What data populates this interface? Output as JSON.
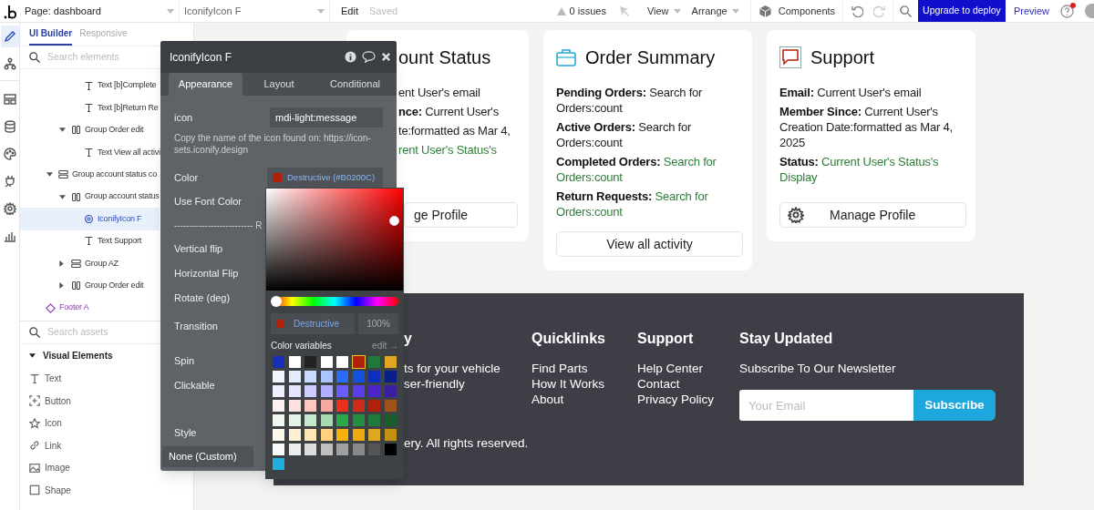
{
  "topbar": {
    "page_select": "Page: dashboard",
    "element_select": "IconifyIcon F",
    "edit": "Edit",
    "saved": "Saved",
    "issues": "0 issues",
    "view": "View",
    "arrange": "Arrange",
    "components": "Components",
    "upgrade": "Upgrade to deploy",
    "preview": "Preview",
    "help_notification": true
  },
  "rail": [
    {
      "kind": "pencil",
      "selected": true
    },
    {
      "kind": "tree",
      "selected": false
    },
    {
      "kind": "layout",
      "selected": false
    },
    {
      "kind": "database",
      "selected": false
    },
    {
      "kind": "palette",
      "selected": false
    },
    {
      "kind": "plug",
      "selected": false
    },
    {
      "kind": "gear",
      "selected": false
    },
    {
      "kind": "chart",
      "selected": false
    }
  ],
  "sidebar": {
    "tabs": [
      {
        "label": "UI Builder",
        "selected": true
      },
      {
        "label": "Responsive",
        "selected": false
      }
    ],
    "search": {
      "placeholder": "Search elements"
    },
    "tree": [
      {
        "children": [
          {
            "children": [
              {
                "children": [
                  {
                    "label": "Text [b]Complete",
                    "kind": "text",
                    "selected": false
                  },
                  {
                    "label": "Text [b]Return Re",
                    "kind": "text",
                    "selected": false
                  }
                ]
              },
              {
                "label": "Group Order edit",
                "kind": "row",
                "selected": false,
                "expanded": true,
                "children": [
                  {
                    "label": "Text View all activi",
                    "kind": "text",
                    "selected": false
                  }
                ]
              }
            ]
          },
          {
            "label": "Group account status co",
            "kind": "column",
            "selected": false,
            "expanded": true,
            "children": [
              {
                "label": "Group account status",
                "kind": "row",
                "selected": false,
                "expanded": true,
                "children": [
                  {
                    "label": "IconifyIcon F",
                    "kind": "icon",
                    "selected": true
                  },
                  {
                    "label": "Text Support",
                    "kind": "text",
                    "selected": false
                  }
                ]
              },
              {
                "label": "Group AZ",
                "kind": "column",
                "selected": false,
                "expanded": false
              },
              {
                "label": "Group Order edit",
                "kind": "row",
                "selected": false,
                "expanded": false
              }
            ]
          }
        ]
      },
      {
        "label": "Footer A",
        "kind": "reusable",
        "selected": false
      }
    ],
    "assets_search": {
      "placeholder": "Search assets"
    },
    "asset_section": {
      "label": "Visual Elements",
      "expanded": true,
      "items": [
        {
          "label": "Text",
          "kind": "text"
        },
        {
          "label": "Button",
          "kind": "button"
        },
        {
          "label": "Icon",
          "kind": "icon"
        },
        {
          "label": "Link",
          "kind": "link"
        },
        {
          "label": "Image",
          "kind": "image"
        },
        {
          "label": "Shape",
          "kind": "shape"
        }
      ]
    }
  },
  "cards": [
    {
      "title": "ount Status",
      "items": [
        {
          "value": "ent User's email",
          "dynamic": false
        },
        {
          "label": "nce:",
          "value": "Current User's",
          "dynamic": false
        },
        {
          "value": "te:formatted as Mar 4,",
          "dynamic": false
        },
        {
          "value": "rent User's Status's",
          "dynamic": true
        }
      ],
      "button": {
        "label": "ge Profile"
      }
    },
    {
      "title": "Order Summary",
      "items": [
        {
          "label": "Pending Orders:",
          "value": "Search for Orders:count",
          "dynamic": false
        },
        {
          "label": "Active Orders:",
          "value": "Search for Orders:count",
          "dynamic": false
        },
        {
          "label": "Completed Orders:",
          "value": "Search for Orders:count",
          "dynamic": true
        },
        {
          "label": "Return Requests:",
          "value": "Search for Orders:count",
          "dynamic": true
        }
      ],
      "button": {
        "label": "View all activity"
      }
    },
    {
      "title": "Support",
      "items": [
        {
          "label": "Email:",
          "value": "Current User's email",
          "dynamic": false
        },
        {
          "label": "Member Since:",
          "value": "Current User's Creation Date:formatted as Mar 4, 2025",
          "dynamic": false
        },
        {
          "label": "Status:",
          "value": "Current User's Status's Display",
          "dynamic": true
        }
      ],
      "button": {
        "label": "Manage Profile"
      }
    }
  ],
  "footer": {
    "columns": [
      {
        "kind": "text",
        "heading": "y",
        "lines": [
          "ts for your vehicle",
          "ser-friendly"
        ]
      },
      {
        "kind": "links",
        "heading": "Quicklinks",
        "lines": [
          "Find Parts",
          "How It Works",
          "About"
        ]
      },
      {
        "kind": "links",
        "heading": "Support",
        "lines": [
          "Help Center",
          "Contact",
          "Privacy Policy"
        ]
      },
      {
        "kind": "newsletter",
        "heading": "Stay Updated",
        "lines": [
          "Subscribe To Our Newsletter"
        ],
        "email_placeholder": "Your Email",
        "button": "Subscribe"
      }
    ],
    "copyright": "ery. All rights reserved."
  },
  "panel": {
    "title": "IconifyIcon F",
    "tabs": [
      {
        "label": "Appearance",
        "selected": true
      },
      {
        "label": "Layout",
        "selected": false
      },
      {
        "label": "Conditional",
        "selected": false
      }
    ],
    "rows": [
      {
        "kind": "field",
        "label": "icon",
        "value": "mdi-light:message"
      },
      {
        "kind": "hint",
        "text": "Copy the name of the icon found on: https://icon-sets.iconify.design"
      },
      {
        "kind": "color",
        "label": "Color",
        "value": "Destructive (#B0200C)",
        "color": "#b0200c"
      },
      {
        "kind": "setting",
        "label": "Use Font Color"
      },
      {
        "kind": "section",
        "label": "-------------------------- R"
      },
      {
        "kind": "setting",
        "label": "Vertical flip"
      },
      {
        "kind": "setting",
        "label": "Horizontal Flip"
      },
      {
        "kind": "setting",
        "label": "Rotate (deg)"
      },
      {
        "kind": "select",
        "label": "Transition"
      },
      {
        "kind": "setting",
        "label": "Spin"
      },
      {
        "kind": "setting",
        "label": "Clickable"
      },
      {
        "kind": "dropdown",
        "label": "Style",
        "value": "None (Custom)"
      }
    ]
  },
  "color_picker": {
    "hue": {
      "level": 0
    },
    "name": "Destructive",
    "opacity": "100%",
    "variables_label": "Color variables",
    "edit_link": "edit →",
    "swatches": [
      {
        "color": "#1a2fb8",
        "selected": false
      },
      {
        "color": "#ffffff",
        "selected": false
      },
      {
        "color": "#222222",
        "selected": false
      },
      {
        "color": "#ffffff",
        "selected": false
      },
      {
        "color": "#ffffff",
        "selected": false
      },
      {
        "color": "#b0200c",
        "selected": true
      },
      {
        "color": "#1f7a3a",
        "selected": false
      },
      {
        "color": "#e0a820",
        "selected": false
      },
      {
        "color": "#f0f4ff",
        "selected": false
      },
      {
        "color": "#e3ecff",
        "selected": false
      },
      {
        "color": "#c9dbff",
        "selected": false
      },
      {
        "color": "#a9c5ff",
        "selected": false
      },
      {
        "color": "#2a6cf5",
        "selected": false
      },
      {
        "color": "#1450e0",
        "selected": false
      },
      {
        "color": "#0d2fc0",
        "selected": false
      },
      {
        "color": "#0a1e8a",
        "selected": false
      },
      {
        "color": "#eeeeff",
        "selected": false
      },
      {
        "color": "#e4e4ff",
        "selected": false
      },
      {
        "color": "#cdcdff",
        "selected": false
      },
      {
        "color": "#b0b0ff",
        "selected": false
      },
      {
        "color": "#6b5cff",
        "selected": false
      },
      {
        "color": "#5a3de8",
        "selected": false
      },
      {
        "color": "#4b25c8",
        "selected": false
      },
      {
        "color": "#3c1fa0",
        "selected": false
      },
      {
        "color": "#fff0f0",
        "selected": false
      },
      {
        "color": "#ffe0e0",
        "selected": false
      },
      {
        "color": "#ffc7c0",
        "selected": false
      },
      {
        "color": "#f5a8a0",
        "selected": false
      },
      {
        "color": "#e8301a",
        "selected": false
      },
      {
        "color": "#d02a18",
        "selected": false
      },
      {
        "color": "#b0200c",
        "selected": false
      },
      {
        "color": "#a0521a",
        "selected": false
      },
      {
        "color": "#f0f8f0",
        "selected": false
      },
      {
        "color": "#e3f3e5",
        "selected": false
      },
      {
        "color": "#c7e8cc",
        "selected": false
      },
      {
        "color": "#a8dab2",
        "selected": false
      },
      {
        "color": "#2aa84a",
        "selected": false
      },
      {
        "color": "#229040",
        "selected": false
      },
      {
        "color": "#1f7a3a",
        "selected": false
      },
      {
        "color": "#1a5c2a",
        "selected": false
      },
      {
        "color": "#fff8ea",
        "selected": false
      },
      {
        "color": "#ffefd3",
        "selected": false
      },
      {
        "color": "#ffe4b5",
        "selected": false
      },
      {
        "color": "#ffd27f",
        "selected": false
      },
      {
        "color": "#f7b00c",
        "selected": false
      },
      {
        "color": "#efa80e",
        "selected": false
      },
      {
        "color": "#e0a820",
        "selected": false
      },
      {
        "color": "#c4900f",
        "selected": false
      },
      {
        "color": "#fafafa",
        "selected": false
      },
      {
        "color": "#eeeeee",
        "selected": false
      },
      {
        "color": "#dddddd",
        "selected": false
      },
      {
        "color": "#c0c0c0",
        "selected": false
      },
      {
        "color": "#a0a0a0",
        "selected": false
      },
      {
        "color": "#888888",
        "selected": false
      },
      {
        "color": "#555555",
        "selected": false
      },
      {
        "color": "#000000",
        "selected": false
      },
      {
        "color": "#20b0e0",
        "selected": false
      }
    ]
  }
}
